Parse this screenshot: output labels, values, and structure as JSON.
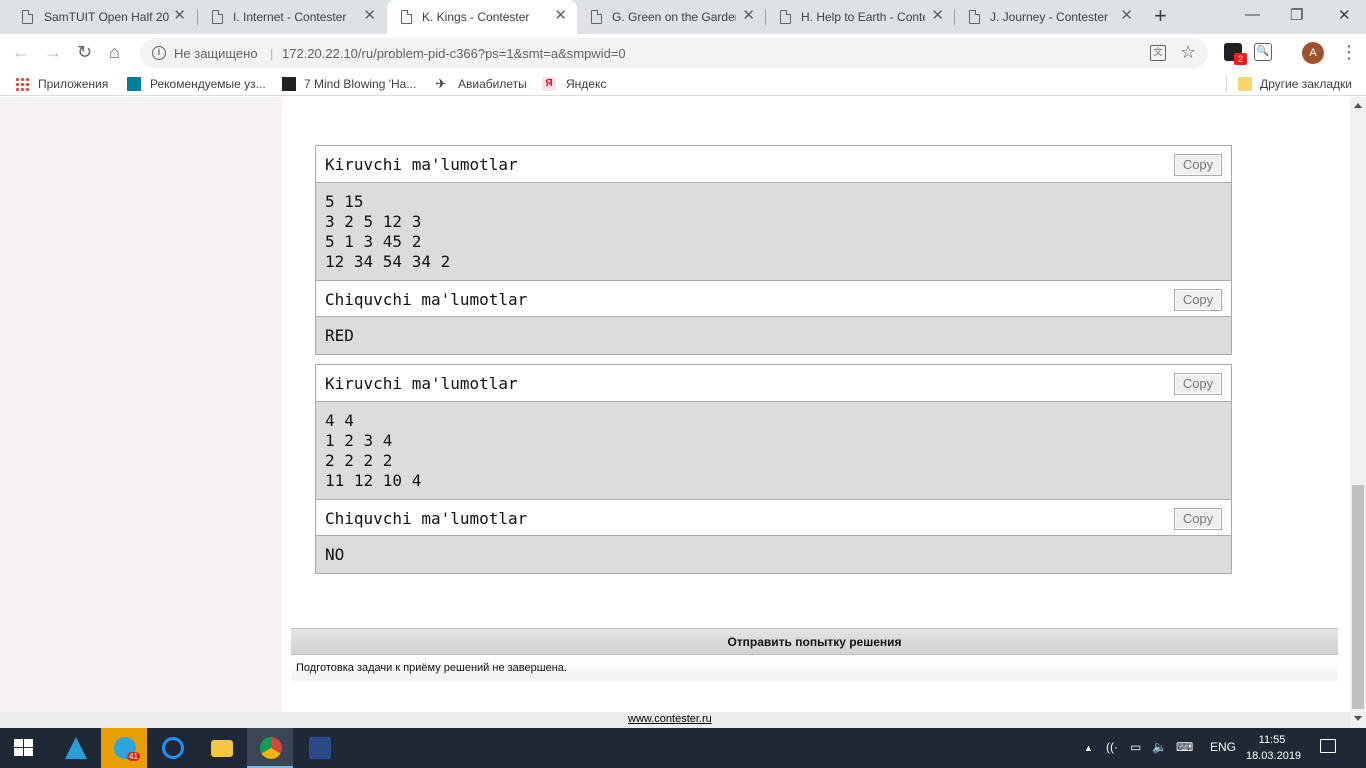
{
  "tabs": [
    {
      "title": "SamTUIT Open Half 20",
      "close": "✕"
    },
    {
      "title": "I. Internet - Contester",
      "close": "✕"
    },
    {
      "title": "K. Kings - Contester",
      "close": "✕"
    },
    {
      "title": "G. Green on the Garden",
      "close": "✕"
    },
    {
      "title": "H. Help to Earth - Conte",
      "close": "✕"
    },
    {
      "title": "J. Journey - Contester",
      "close": "✕"
    }
  ],
  "new_tab_label": "+",
  "window_controls": {
    "minimize": "—",
    "restore": "❐",
    "close": "✕"
  },
  "toolbar": {
    "back": "←",
    "forward": "→",
    "reload": "↻",
    "home": "⌂",
    "info": "i",
    "security_label": "Не защищено",
    "separator": "|",
    "url": "172.20.22.10/ru/problem-pid-c366?ps=1&smt=a&smpwid=0",
    "translate": "文",
    "star": "☆",
    "ext_badge": "2",
    "ext2": "🔍",
    "avatar_letter": "A",
    "menu": "⋮"
  },
  "bookmarks": {
    "apps": "Приложения",
    "recommended": "Рекомендуемые уз...",
    "mind": "7 Mind Blowing 'Ha...",
    "tickets": "Авиабилеты",
    "yandex": "Яндекс",
    "yandex_icon": "Я",
    "other": "Другие закладки"
  },
  "examples": [
    {
      "input_title": "Kiruvchi ma'lumotlar",
      "input": "5 15\n3 2 5 12 3\n5 1 3 45 2\n12 34 54 34 2",
      "output_title": "Chiquvchi ma'lumotlar",
      "output": "RED",
      "copy_label": "Copy"
    },
    {
      "input_title": "Kiruvchi ma'lumotlar",
      "input": "4 4\n1 2 3 4\n2 2 2 2\n11 12 10 4",
      "output_title": "Chiquvchi ma'lumotlar",
      "output": "NO",
      "copy_label": "Copy"
    }
  ],
  "submit": {
    "title": "Отправить попытку решения",
    "message": "Подготовка задачи к приёму решений не завершена."
  },
  "footer": {
    "link": "www.contester.ru"
  },
  "taskbar": {
    "telegram_badge": "41",
    "tray_lang": "ENG",
    "tray_up": "▲",
    "tray_wifi": "((·",
    "tray_battery": "▭",
    "tray_volume": "🔈",
    "tray_keyboard": "⌨",
    "time": "11:55",
    "date": "18.03.2019"
  }
}
